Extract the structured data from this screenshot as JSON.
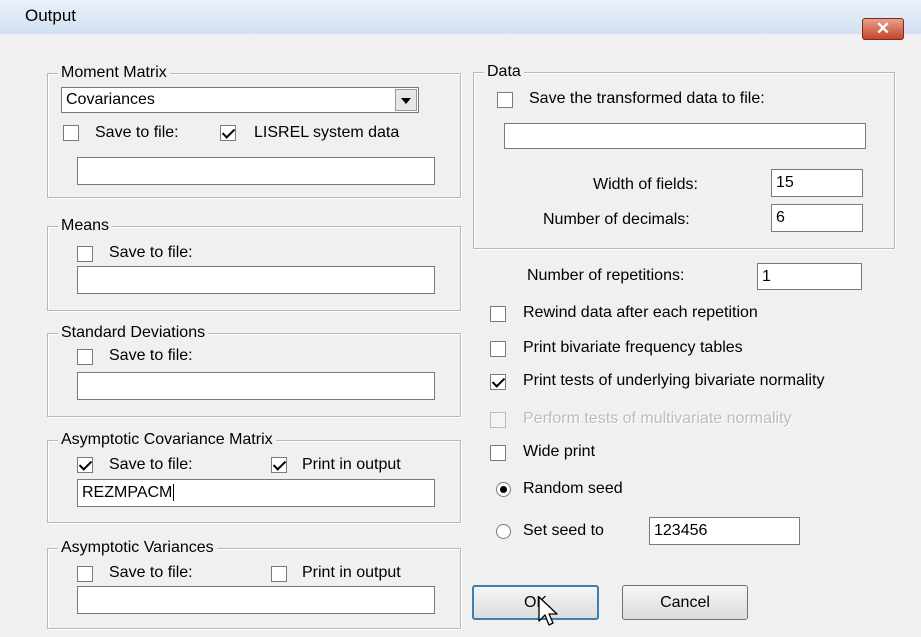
{
  "window": {
    "title": "Output",
    "close_glyph": "✕"
  },
  "moment_matrix": {
    "legend": "Moment Matrix",
    "type_selected": "Covariances",
    "save_label": "Save to file:",
    "save_checked": false,
    "lisrel_label": "LISREL system data",
    "lisrel_checked": true,
    "file_value": ""
  },
  "means": {
    "legend": "Means",
    "save_label": "Save to file:",
    "save_checked": false,
    "file_value": ""
  },
  "std_dev": {
    "legend": "Standard Deviations",
    "save_label": "Save to file:",
    "save_checked": false,
    "file_value": ""
  },
  "acm": {
    "legend": "Asymptotic Covariance Matrix",
    "save_label": "Save to file:",
    "save_checked": true,
    "print_label": "Print in output",
    "print_checked": true,
    "file_value": "REZMPACM"
  },
  "avar": {
    "legend": "Asymptotic Variances",
    "save_label": "Save to file:",
    "save_checked": false,
    "print_label": "Print in output",
    "print_checked": false,
    "file_value": ""
  },
  "data": {
    "legend": "Data",
    "save_label": "Save the transformed data to file:",
    "save_checked": false,
    "file_value": "",
    "width_label": "Width of fields:",
    "width_value": "15",
    "decimals_label": "Number of decimals:",
    "decimals_value": "6"
  },
  "options": {
    "repetitions_label": "Number of repetitions:",
    "repetitions_value": "1",
    "rewind_label": "Rewind data after each repetition",
    "rewind_checked": false,
    "bivariate_freq_label": "Print bivariate frequency tables",
    "bivariate_freq_checked": false,
    "bivariate_norm_label": "Print tests of underlying bivariate normality",
    "bivariate_norm_checked": true,
    "multivariate_label": "Perform tests of multivariate normality",
    "multivariate_checked": false,
    "multivariate_enabled": false,
    "wide_label": "Wide print",
    "wide_checked": false,
    "random_seed_label": "Random seed",
    "random_seed_selected": true,
    "set_seed_label": "Set seed to",
    "seed_value": "123456"
  },
  "buttons": {
    "ok": "OK",
    "cancel": "Cancel"
  },
  "icons": {
    "cursor": "mouse-pointer-icon",
    "dropdown": "chevron-down-icon",
    "close": "close-icon"
  }
}
